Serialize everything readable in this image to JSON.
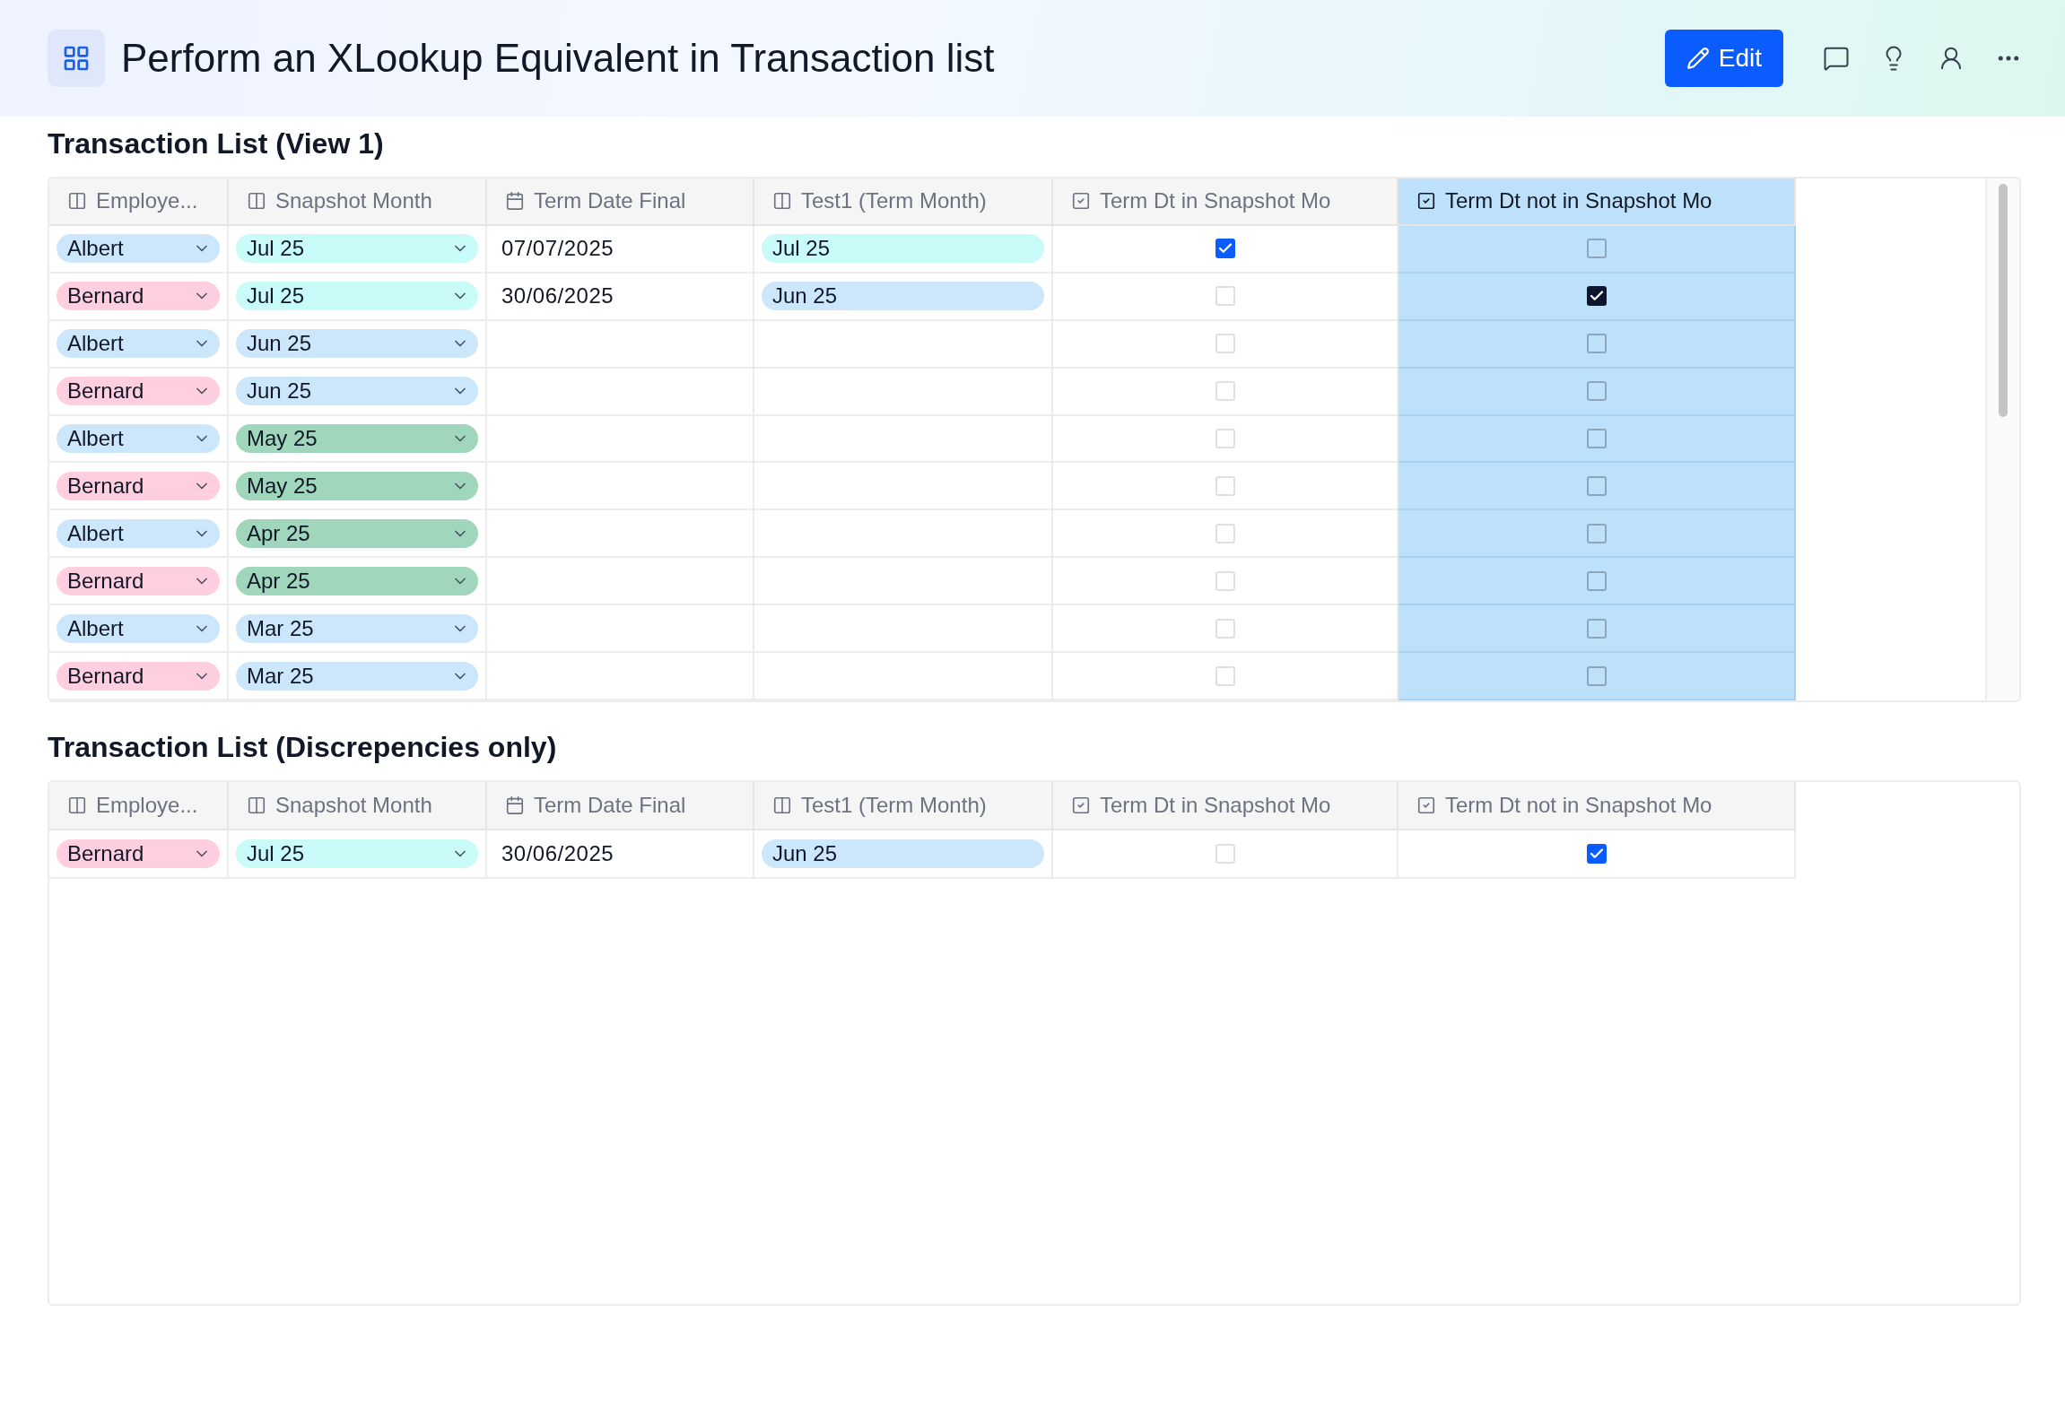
{
  "page": {
    "title": "Perform an XLookup Equivalent in Transaction list",
    "actions": [
      {
        "kind": "edit",
        "label": "Edit"
      },
      {
        "kind": "comment"
      },
      {
        "kind": "idea"
      },
      {
        "kind": "share"
      },
      {
        "kind": "more"
      }
    ]
  },
  "tables": [
    {
      "title": "Transaction List (View 1)",
      "columns": [
        {
          "label": "Employe...",
          "kind": "lookup",
          "selected": false
        },
        {
          "label": "Snapshot Month",
          "kind": "lookup",
          "selected": false
        },
        {
          "label": "Term Date Final",
          "kind": "date",
          "selected": false
        },
        {
          "label": "Test1 (Term Month)",
          "kind": "lookup",
          "selected": false
        },
        {
          "label": "Term Dt in Snapshot Mo",
          "kind": "checkbox",
          "selected": false
        },
        {
          "label": "Term Dt not in Snapshot Mo",
          "kind": "checkbox",
          "selected": true
        }
      ],
      "rows": [
        [
          {
            "kind": "select",
            "text": "Albert",
            "color": "#cce6fc"
          },
          {
            "kind": "select",
            "text": "Jul 25",
            "color": "#c9fbf8"
          },
          {
            "kind": "text",
            "text": "07/07/2025"
          },
          {
            "kind": "pill",
            "text": "Jul 25",
            "color": "#c9fbf8"
          },
          {
            "kind": "checkbox",
            "checked": true
          },
          {
            "kind": "checkbox",
            "checked": false
          }
        ],
        [
          {
            "kind": "select",
            "text": "Bernard",
            "color": "#ffcfdf"
          },
          {
            "kind": "select",
            "text": "Jul 25",
            "color": "#c9fbf8"
          },
          {
            "kind": "text",
            "text": "30/06/2025"
          },
          {
            "kind": "pill",
            "text": "Jun 25",
            "color": "#cce6fc"
          },
          {
            "kind": "checkbox",
            "checked": false
          },
          {
            "kind": "checkbox",
            "checked": true
          }
        ],
        [
          {
            "kind": "select",
            "text": "Albert",
            "color": "#cce6fc"
          },
          {
            "kind": "select",
            "text": "Jun 25",
            "color": "#cce6fc"
          },
          {
            "kind": "empty"
          },
          {
            "kind": "empty"
          },
          {
            "kind": "checkbox",
            "checked": false
          },
          {
            "kind": "checkbox",
            "checked": false
          }
        ],
        [
          {
            "kind": "select",
            "text": "Bernard",
            "color": "#ffcfdf"
          },
          {
            "kind": "select",
            "text": "Jun 25",
            "color": "#cce6fc"
          },
          {
            "kind": "empty"
          },
          {
            "kind": "empty"
          },
          {
            "kind": "checkbox",
            "checked": false
          },
          {
            "kind": "checkbox",
            "checked": false
          }
        ],
        [
          {
            "kind": "select",
            "text": "Albert",
            "color": "#cce6fc"
          },
          {
            "kind": "select",
            "text": "May 25",
            "color": "#a0d6bc"
          },
          {
            "kind": "empty"
          },
          {
            "kind": "empty"
          },
          {
            "kind": "checkbox",
            "checked": false
          },
          {
            "kind": "checkbox",
            "checked": false
          }
        ],
        [
          {
            "kind": "select",
            "text": "Bernard",
            "color": "#ffcfdf"
          },
          {
            "kind": "select",
            "text": "May 25",
            "color": "#a0d6bc"
          },
          {
            "kind": "empty"
          },
          {
            "kind": "empty"
          },
          {
            "kind": "checkbox",
            "checked": false
          },
          {
            "kind": "checkbox",
            "checked": false
          }
        ],
        [
          {
            "kind": "select",
            "text": "Albert",
            "color": "#cce6fc"
          },
          {
            "kind": "select",
            "text": "Apr 25",
            "color": "#a0d6bc"
          },
          {
            "kind": "empty"
          },
          {
            "kind": "empty"
          },
          {
            "kind": "checkbox",
            "checked": false
          },
          {
            "kind": "checkbox",
            "checked": false
          }
        ],
        [
          {
            "kind": "select",
            "text": "Bernard",
            "color": "#ffcfdf"
          },
          {
            "kind": "select",
            "text": "Apr 25",
            "color": "#a0d6bc"
          },
          {
            "kind": "empty"
          },
          {
            "kind": "empty"
          },
          {
            "kind": "checkbox",
            "checked": false
          },
          {
            "kind": "checkbox",
            "checked": false
          }
        ],
        [
          {
            "kind": "select",
            "text": "Albert",
            "color": "#cce6fc"
          },
          {
            "kind": "select",
            "text": "Mar 25",
            "color": "#cce6fc"
          },
          {
            "kind": "empty"
          },
          {
            "kind": "empty"
          },
          {
            "kind": "checkbox",
            "checked": false
          },
          {
            "kind": "checkbox",
            "checked": false
          }
        ],
        [
          {
            "kind": "select",
            "text": "Bernard",
            "color": "#ffcfdf"
          },
          {
            "kind": "select",
            "text": "Mar 25",
            "color": "#cce6fc"
          },
          {
            "kind": "empty"
          },
          {
            "kind": "empty"
          },
          {
            "kind": "checkbox",
            "checked": false
          },
          {
            "kind": "checkbox",
            "checked": false
          }
        ]
      ]
    },
    {
      "title": "Transaction List (Discrepencies only)",
      "columns": [
        {
          "label": "Employe...",
          "kind": "lookup",
          "selected": false
        },
        {
          "label": "Snapshot Month",
          "kind": "lookup",
          "selected": false
        },
        {
          "label": "Term Date Final",
          "kind": "date",
          "selected": false
        },
        {
          "label": "Test1 (Term Month)",
          "kind": "lookup",
          "selected": false
        },
        {
          "label": "Term Dt in Snapshot Mo",
          "kind": "checkbox",
          "selected": false
        },
        {
          "label": "Term Dt not in Snapshot Mo",
          "kind": "checkbox",
          "selected": false
        }
      ],
      "rows": [
        [
          {
            "kind": "select",
            "text": "Bernard",
            "color": "#ffcfdf"
          },
          {
            "kind": "select",
            "text": "Jul 25",
            "color": "#c9fbf8"
          },
          {
            "kind": "text",
            "text": "30/06/2025"
          },
          {
            "kind": "pill",
            "text": "Jun 25",
            "color": "#cce6fc"
          },
          {
            "kind": "checkbox",
            "checked": false
          },
          {
            "kind": "checkbox",
            "checked": true
          }
        ]
      ]
    }
  ]
}
